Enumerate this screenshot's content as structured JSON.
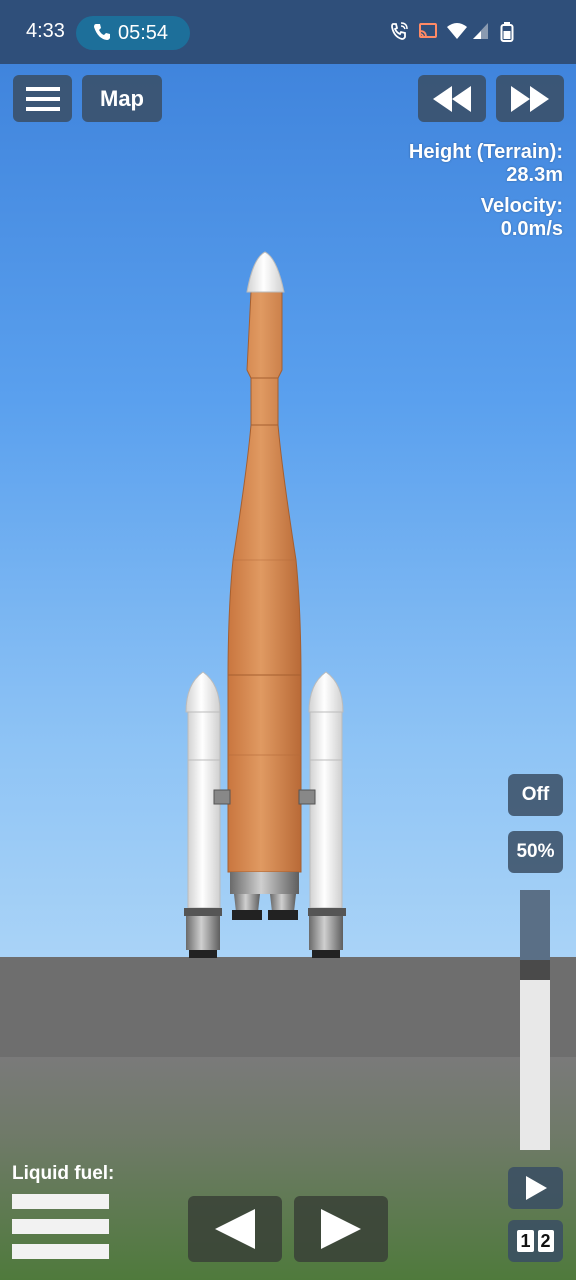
{
  "status_bar": {
    "time": "4:33",
    "call_timer": "05:54",
    "icons": [
      "wifi-calling-icon",
      "cast-icon",
      "wifi-icon",
      "signal-icon",
      "battery-icon"
    ]
  },
  "toolbar": {
    "menu_icon": "hamburger-menu-icon",
    "map_label": "Map",
    "rewind_icon": "rewind-icon",
    "fast_forward_icon": "fast-forward-icon"
  },
  "telemetry": {
    "height_label": "Height (Terrain):",
    "height_value": "28.3m",
    "velocity_label": "Velocity:",
    "velocity_value": "0.0m/s"
  },
  "controls": {
    "sas_label": "Off",
    "throttle_label": "50%",
    "throttle_level": 0.5,
    "stage_play_icon": "play-icon",
    "stage_numbers": [
      "1",
      "2"
    ],
    "rotate_left_icon": "rotate-left-arrow-icon",
    "rotate_right_icon": "rotate-right-arrow-icon"
  },
  "fuel": {
    "label": "Liquid fuel:",
    "bars": 3
  },
  "colors": {
    "status_bar": "#2f4f7a",
    "button_bg": "#3a4e64",
    "rocket_tank": "#d8874d",
    "booster": "#ececec",
    "ground": "#6e6e6e"
  }
}
